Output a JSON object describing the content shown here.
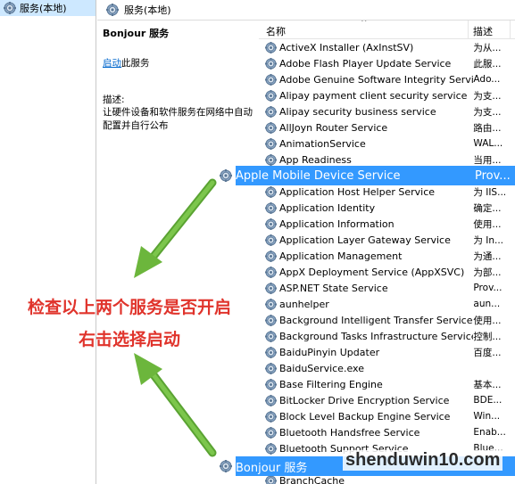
{
  "left_tree": {
    "item_label": "服务(本地)"
  },
  "main_header": {
    "title": "服务(本地)"
  },
  "description_pane": {
    "service_title": "Bonjour 服务",
    "start_link": "启动",
    "start_suffix": "此服务",
    "desc_label": "描述:",
    "desc_text": "让硬件设备和软件服务在网络中自动配置并自行公布"
  },
  "columns": {
    "name": "名称",
    "description": "描述"
  },
  "services": [
    {
      "name": "ActiveX Installer (AxInstSV)",
      "desc": "为从..."
    },
    {
      "name": "Adobe Flash Player Update Service",
      "desc": "此服..."
    },
    {
      "name": "Adobe Genuine Software Integrity Service",
      "desc": "Ado..."
    },
    {
      "name": "Alipay payment client security service",
      "desc": "为支..."
    },
    {
      "name": "Alipay security business service",
      "desc": "为支..."
    },
    {
      "name": "AllJoyn Router Service",
      "desc": "路由..."
    },
    {
      "name": "AnimationService",
      "desc": "WAL..."
    },
    {
      "name": "App Readiness",
      "desc": "当用..."
    },
    {
      "name": "",
      "desc": ""
    },
    {
      "name": "Application Host Helper Service",
      "desc": "为 IIS..."
    },
    {
      "name": "Application Identity",
      "desc": "确定..."
    },
    {
      "name": "Application Information",
      "desc": "使用..."
    },
    {
      "name": "Application Layer Gateway Service",
      "desc": "为 In..."
    },
    {
      "name": "Application Management",
      "desc": "为通..."
    },
    {
      "name": "AppX Deployment Service (AppXSVC)",
      "desc": "为部..."
    },
    {
      "name": "ASP.NET State Service",
      "desc": "Prov..."
    },
    {
      "name": "aunhelper",
      "desc": "aun..."
    },
    {
      "name": "Background Intelligent Transfer Service",
      "desc": "使用..."
    },
    {
      "name": "Background Tasks Infrastructure Service",
      "desc": "控制..."
    },
    {
      "name": "BaiduPinyin Updater",
      "desc": "百度..."
    },
    {
      "name": "BaiduService.exe",
      "desc": ""
    },
    {
      "name": "Base Filtering Engine",
      "desc": "基本..."
    },
    {
      "name": "BitLocker Drive Encryption Service",
      "desc": "BDE..."
    },
    {
      "name": "Block Level Backup Engine Service",
      "desc": "Win..."
    },
    {
      "name": "Bluetooth Handsfree Service",
      "desc": "Enab..."
    },
    {
      "name": "Bluetooth Support Service",
      "desc": "Blue..."
    },
    {
      "name": "",
      "desc": ""
    },
    {
      "name": "BranchCache",
      "desc": ""
    }
  ],
  "highlighted": {
    "apple": {
      "name": "Apple Mobile Device Service",
      "desc": "Prov..."
    },
    "bonjour": {
      "name": "Bonjour 服务",
      "desc": ""
    }
  },
  "annotation": {
    "line1": "检查以上两个服务是否开启",
    "line2": "右击选择启动"
  },
  "watermark": "shenduwin10.com",
  "colors": {
    "selection": "#3399ff",
    "annotation": "#e0342c",
    "arrow": "#6cb63c",
    "link": "#0066cc"
  },
  "icons": {
    "tree": "services-icon",
    "row": "gear-icon"
  }
}
